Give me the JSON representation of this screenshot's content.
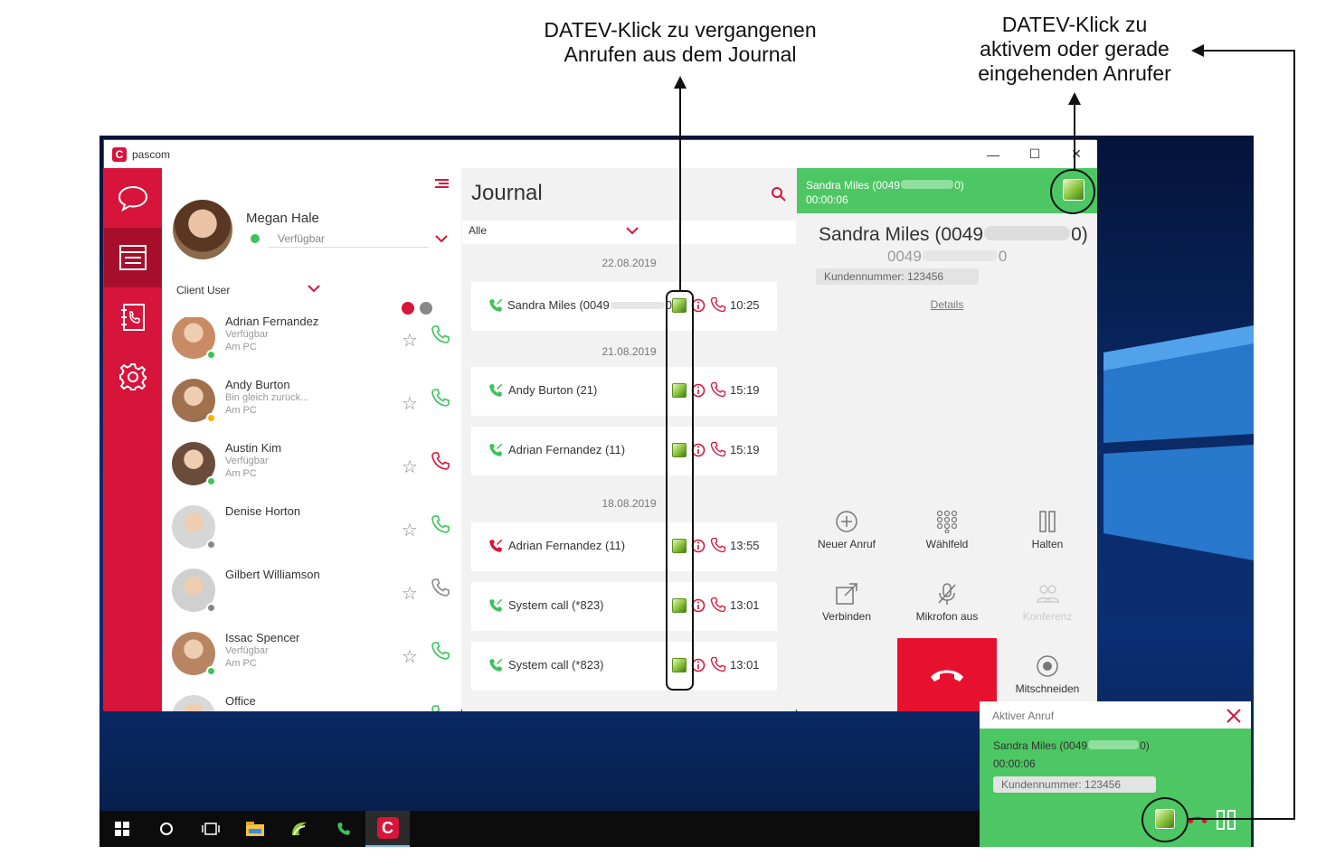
{
  "annotations": {
    "journal_line1": "DATEV-Klick zu vergangenen",
    "journal_line2": "Anrufen aus dem Journal",
    "active_line1": "DATEV-Klick zu",
    "active_line2": "aktivem oder gerade",
    "active_line3": "eingehenden Anrufer"
  },
  "window": {
    "title": "pascom",
    "minimize": "—",
    "maximize": "☐",
    "close": "✕"
  },
  "user": {
    "name": "Megan Hale",
    "status": "Verfügbar",
    "group": "Client User"
  },
  "contacts": [
    {
      "name": "Adrian Fernandez",
      "line1": "Verfügbar",
      "line2": "Am PC",
      "status_color": "#3cc35a",
      "phone_color": "#3cc35a"
    },
    {
      "name": "Andy Burton",
      "line1": "Bin gleich zurück...",
      "line2": "Am PC",
      "status_color": "#f5b400",
      "phone_color": "#3cc35a"
    },
    {
      "name": "Austin Kim",
      "line1": "Verfügbar",
      "line2": "Am PC",
      "status_color": "#3cc35a",
      "phone_color": "#d7143a"
    },
    {
      "name": "Denise Horton",
      "line1": "",
      "line2": "",
      "status_color": "#888888",
      "phone_color": "#3cc35a"
    },
    {
      "name": "Gilbert Williamson",
      "line1": "",
      "line2": "",
      "status_color": "#888888",
      "phone_color": "#888888"
    },
    {
      "name": "Issac Spencer",
      "line1": "Verfügbar",
      "line2": "Am PC",
      "status_color": "#3cc35a",
      "phone_color": "#3cc35a"
    },
    {
      "name": "Office",
      "line1": "",
      "line2": "",
      "status_color": "#888888",
      "phone_color": "#3cc35a"
    }
  ],
  "journal": {
    "title": "Journal",
    "filter": "Alle",
    "dates": [
      "22.08.2019",
      "21.08.2019",
      "18.08.2019"
    ],
    "entries": [
      {
        "name": "Sandra Miles (0049",
        "name_end": "0)",
        "time": "10:25",
        "incoming": true
      },
      {
        "name": "Andy Burton (21)",
        "name_end": "",
        "time": "15:19",
        "incoming": false
      },
      {
        "name": "Adrian Fernandez (11)",
        "name_end": "",
        "time": "15:19",
        "incoming": false
      },
      {
        "name": "Adrian Fernandez (11)",
        "name_end": "",
        "time": "13:55",
        "incoming": false
      },
      {
        "name": "System call (*823)",
        "name_end": "",
        "time": "13:01",
        "incoming": false
      },
      {
        "name": "System call (*823)",
        "name_end": "",
        "time": "13:01",
        "incoming": false
      }
    ]
  },
  "call": {
    "header_name": "Sandra Miles (0049",
    "header_name_end": "0)",
    "duration": "00:00:06",
    "big_name": "Sandra Miles (0049",
    "big_name_end": "0)",
    "number_start": "0049",
    "number_end": "0",
    "customer": "Kundennummer: 123456",
    "details": "Details",
    "actions": {
      "new_call": "Neuer Anruf",
      "dialpad": "Wählfeld",
      "hold": "Halten",
      "transfer": "Verbinden",
      "mute": "Mikrofon aus",
      "conference": "Konferenz",
      "record": "Mitschneiden"
    }
  },
  "notification": {
    "title": "Aktiver Anruf",
    "name": "Sandra Miles (0049",
    "name_end": "0)",
    "duration": "00:00:06",
    "customer": "Kundennummer: 123456"
  },
  "colors": {
    "brand_red": "#d7143a",
    "call_green": "#4cc764"
  }
}
